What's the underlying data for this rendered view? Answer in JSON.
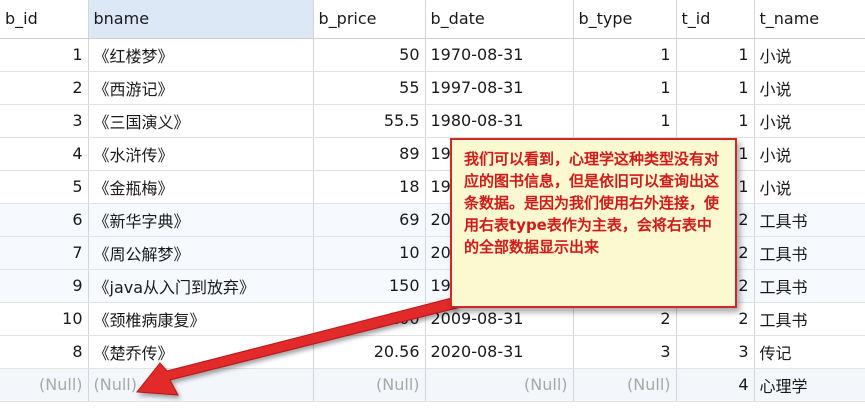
{
  "columns": [
    "b_id",
    "bname",
    "b_price",
    "b_date",
    "b_type",
    "t_id",
    "t_name"
  ],
  "rows": [
    [
      "1",
      "《红楼梦》",
      "50",
      "1970-08-31",
      "1",
      "1",
      "小说"
    ],
    [
      "2",
      "《西游记》",
      "55",
      "1997-08-31",
      "1",
      "1",
      "小说"
    ],
    [
      "3",
      "《三国演义》",
      "55.5",
      "1980-08-31",
      "1",
      "1",
      "小说"
    ],
    [
      "4",
      "《水浒传》",
      "89",
      "19",
      "",
      "1",
      "小说"
    ],
    [
      "5",
      "《金瓶梅》",
      "18",
      "19",
      "",
      "1",
      "小说"
    ],
    [
      "6",
      "《新华字典》",
      "69",
      "20",
      "",
      "2",
      "工具书"
    ],
    [
      "7",
      "《周公解梦》",
      "10",
      "20",
      "",
      "2",
      "工具书"
    ],
    [
      "9",
      "《java从入门到放弃》",
      "150",
      "19",
      "",
      "2",
      "工具书"
    ],
    [
      "10",
      "《颈椎病康复》",
      "200",
      "2009-08-31",
      "2",
      "2",
      "工具书"
    ],
    [
      "8",
      "《楚乔传》",
      "20.56",
      "2020-08-31",
      "3",
      "3",
      "传记"
    ],
    [
      "(Null)",
      "(Null)",
      "(Null)",
      "(Null)",
      "(Null)",
      "4",
      "心理学"
    ]
  ],
  "annotation": {
    "text": "我们可以看到，心理学这种类型没有对应的图书信息，但是依旧可以查询出这条数据。是因为我们使用右外连接，使用右表type表作为主表，会将右表中的全部数据显示出来",
    "color": "#d11a1a",
    "background": "#fcf8cf"
  }
}
